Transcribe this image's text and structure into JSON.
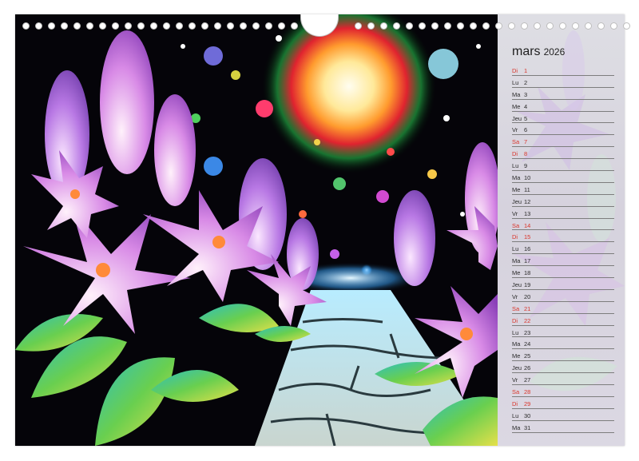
{
  "calendar": {
    "month": "mars",
    "year": "2026",
    "days": [
      {
        "wd": "Di",
        "n": "1",
        "red": true
      },
      {
        "wd": "Lu",
        "n": "2",
        "red": false
      },
      {
        "wd": "Ma",
        "n": "3",
        "red": false
      },
      {
        "wd": "Me",
        "n": "4",
        "red": false
      },
      {
        "wd": "Jeu",
        "n": "5",
        "red": false
      },
      {
        "wd": "Vr",
        "n": "6",
        "red": false
      },
      {
        "wd": "Sa",
        "n": "7",
        "red": true
      },
      {
        "wd": "Di",
        "n": "8",
        "red": true
      },
      {
        "wd": "Lu",
        "n": "9",
        "red": false
      },
      {
        "wd": "Ma",
        "n": "10",
        "red": false
      },
      {
        "wd": "Me",
        "n": "11",
        "red": false
      },
      {
        "wd": "Jeu",
        "n": "12",
        "red": false
      },
      {
        "wd": "Vr",
        "n": "13",
        "red": false
      },
      {
        "wd": "Sa",
        "n": "14",
        "red": true
      },
      {
        "wd": "Di",
        "n": "15",
        "red": true
      },
      {
        "wd": "Lu",
        "n": "16",
        "red": false
      },
      {
        "wd": "Ma",
        "n": "17",
        "red": false
      },
      {
        "wd": "Me",
        "n": "18",
        "red": false
      },
      {
        "wd": "Jeu",
        "n": "19",
        "red": false
      },
      {
        "wd": "Vr",
        "n": "20",
        "red": false
      },
      {
        "wd": "Sa",
        "n": "21",
        "red": true
      },
      {
        "wd": "Di",
        "n": "22",
        "red": true
      },
      {
        "wd": "Lu",
        "n": "23",
        "red": false
      },
      {
        "wd": "Ma",
        "n": "24",
        "red": false
      },
      {
        "wd": "Me",
        "n": "25",
        "red": false
      },
      {
        "wd": "Jeu",
        "n": "26",
        "red": false
      },
      {
        "wd": "Vr",
        "n": "27",
        "red": false
      },
      {
        "wd": "Sa",
        "n": "28",
        "red": true
      },
      {
        "wd": "Di",
        "n": "29",
        "red": true
      },
      {
        "wd": "Lu",
        "n": "30",
        "red": false
      },
      {
        "wd": "Ma",
        "n": "31",
        "red": false
      }
    ]
  },
  "colors": {
    "weekend": "#d9352b",
    "text": "#2b2b2b",
    "rule": "#7d7d7d"
  }
}
